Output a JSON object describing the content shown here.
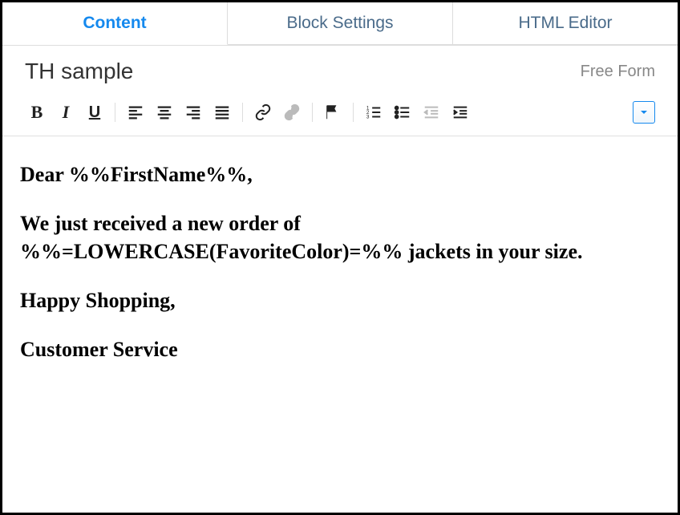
{
  "tabs": {
    "content": "Content",
    "block_settings": "Block Settings",
    "html_editor": "HTML Editor"
  },
  "header": {
    "title": "TH sample",
    "type": "Free Form"
  },
  "editor": {
    "p1": "Dear %%FirstName%%,",
    "p2": "We just received a new order of %%=LOWERCASE(FavoriteColor)=%% jackets in your size.",
    "p3": "Happy Shopping,",
    "p4": "Customer Service"
  }
}
